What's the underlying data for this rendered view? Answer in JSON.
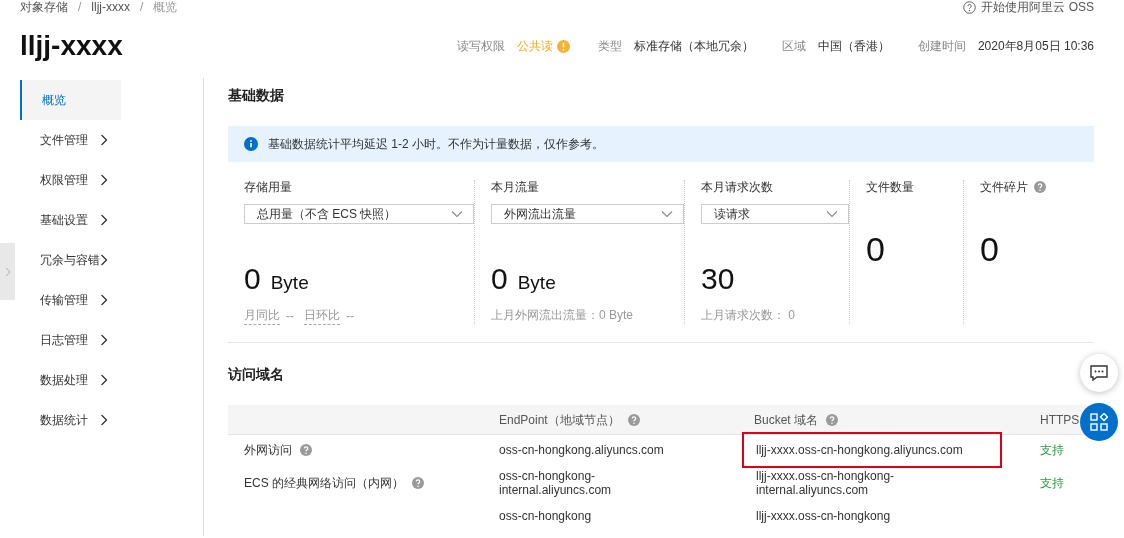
{
  "breadcrumb": [
    {
      "kind": "link",
      "text": "对象存储"
    },
    {
      "kind": "separator",
      "text": "/"
    },
    {
      "kind": "link",
      "text": "lljj-xxxx"
    },
    {
      "kind": "separator",
      "text": "/"
    },
    {
      "kind": "current",
      "text": "概览"
    }
  ],
  "help_link": "开始使用阿里云 OSS",
  "title": "lljj-xxxx",
  "info": [
    {
      "label": "读写权限",
      "value": "公共读",
      "warning": true
    },
    {
      "label": "类型",
      "value": "标准存储（本地冗余）",
      "warning": false
    },
    {
      "label": "区域",
      "value": "中国（香港）",
      "warning": false
    },
    {
      "label": "创建时间",
      "value": "2020年8月05日 10:36",
      "warning": false
    }
  ],
  "sidebar": {
    "items": [
      {
        "label": "概览",
        "selected": true,
        "has_submenu": false
      },
      {
        "label": "文件管理",
        "selected": false,
        "has_submenu": true
      },
      {
        "label": "权限管理",
        "selected": false,
        "has_submenu": true
      },
      {
        "label": "基础设置",
        "selected": false,
        "has_submenu": true
      },
      {
        "label": "冗余与容错",
        "selected": false,
        "has_submenu": true
      },
      {
        "label": "传输管理",
        "selected": false,
        "has_submenu": true
      },
      {
        "label": "日志管理",
        "selected": false,
        "has_submenu": true
      },
      {
        "label": "数据处理",
        "selected": false,
        "has_submenu": true
      },
      {
        "label": "数据统计",
        "selected": false,
        "has_submenu": true
      }
    ]
  },
  "basic_data": {
    "title": "基础数据",
    "notice": "基础数据统计平均延迟 1-2 小时。不作为计量数据，仅作参考。",
    "stats": [
      {
        "label": "存储用量",
        "help": false,
        "select": "总用量（不含 ECS 快照）",
        "value": "0",
        "unit": "Byte",
        "comparisons": [
          {
            "label": "月同比",
            "value": "--"
          },
          {
            "label": "日环比",
            "value": "--"
          }
        ]
      },
      {
        "label": "本月流量",
        "help": false,
        "select": "外网流出流量",
        "value": "0",
        "unit": "Byte",
        "footnote": "上月外网流出流量：0 Byte"
      },
      {
        "label": "本月请求次数",
        "help": false,
        "select": "读请求",
        "value": "30",
        "footnote": "上月请求次数： 0"
      },
      {
        "label": "文件数量",
        "help": false,
        "value": "0"
      },
      {
        "label": "文件碎片",
        "help": true,
        "value": "0"
      }
    ]
  },
  "access_domains": {
    "title": "访问域名",
    "columns": [
      {
        "label": "EndPoint（地域节点）",
        "help": true
      },
      {
        "label": "Bucket 域名",
        "help": true
      },
      {
        "label": "HTTPS",
        "help": false
      }
    ],
    "rows": [
      {
        "name": "外网访问",
        "help": true,
        "endpoint": "oss-cn-hongkong.aliyuncs.com",
        "bucket_domain": "lljj-xxxx.oss-cn-hongkong.aliyuncs.com",
        "https": "支持",
        "highlighted": true
      },
      {
        "name": "ECS 的经典网络访问（内网）",
        "help": true,
        "endpoint": "oss-cn-hongkong-internal.aliyuncs.com",
        "bucket_domain": "lljj-xxxx.oss-cn-hongkong-internal.aliyuncs.com",
        "https": "支持",
        "highlighted": false
      },
      {
        "endpoint": "oss-cn-hongkong",
        "bucket_domain": "lljj-xxxx.oss-cn-hongkong",
        "highlighted": false
      }
    ]
  }
}
